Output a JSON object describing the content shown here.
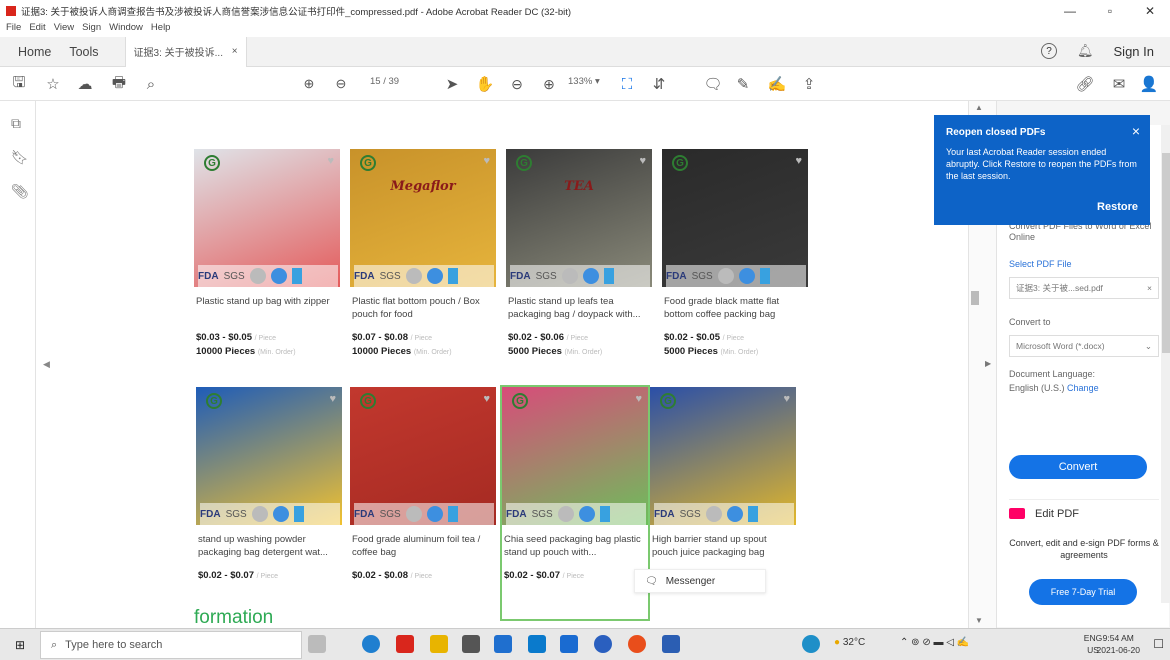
{
  "window": {
    "title": "证据3: 关于被投诉人商调查报告书及涉被投诉人商信誉案涉信息公证书打印件_compressed.pdf - Adobe Acrobat Reader DC (32-bit)"
  },
  "menu": [
    "File",
    "Edit",
    "View",
    "Sign",
    "Window",
    "Help"
  ],
  "tabs": {
    "home": "Home",
    "tools": "Tools",
    "doc": "证据3: 关于被投诉...",
    "close": "×"
  },
  "header": {
    "help_icon": "?",
    "bell_icon": "bell",
    "sign_in": "Sign In"
  },
  "toolbar": {
    "page_current": "15",
    "page_sep": "/",
    "page_total": "39",
    "zoom": "133%"
  },
  "products": [
    {
      "name": "Plastic stand up bag with zipper",
      "price": "$0.03 - $0.05",
      "price_unit": "/ Piece",
      "moq": "10000 Pieces",
      "moq_unit": "(Min. Order)",
      "image_text": "",
      "colors": [
        "#dfe3e8",
        "#e45b5b"
      ]
    },
    {
      "name": "Plastic flat bottom pouch / Box pouch for food",
      "price": "$0.07 - $0.08",
      "price_unit": "/ Piece",
      "moq": "10000 Pieces",
      "moq_unit": "(Min. Order)",
      "image_text": "Megaflor",
      "colors": [
        "#c8922a",
        "#e6b43c"
      ]
    },
    {
      "name": "Plastic stand up leafs tea packaging bag / doypack with...",
      "price": "$0.02 - $0.06",
      "price_unit": "/ Piece",
      "moq": "5000 Pieces",
      "moq_unit": "(Min. Order)",
      "image_text": "TEA",
      "colors": [
        "#3b3b3b",
        "#8a8a7a"
      ]
    },
    {
      "name": "Food grade black matte flat bottom coffee packing bag",
      "price": "$0.02 - $0.05",
      "price_unit": "/ Piece",
      "moq": "5000 Pieces",
      "moq_unit": "(Min. Order)",
      "image_text": "",
      "colors": [
        "#2a2a2a",
        "#3a3a3a"
      ]
    },
    {
      "name": "stand up washing powder packaging bag detergent wat...",
      "price": "$0.02 - $0.07",
      "price_unit": "/ Piece",
      "moq": "",
      "moq_unit": "",
      "image_text": "",
      "colors": [
        "#1e5cb8",
        "#f2c230"
      ]
    },
    {
      "name": "Food grade aluminum foil tea / coffee bag",
      "price": "$0.02 - $0.08",
      "price_unit": "/ Piece",
      "moq": "",
      "moq_unit": "",
      "image_text": "",
      "colors": [
        "#c2382e",
        "#a52a22"
      ]
    },
    {
      "name": "Chia seed packaging bag plastic stand up pouch with...",
      "price": "$0.02 - $0.07",
      "price_unit": "/ Piece",
      "moq": "",
      "moq_unit": "",
      "image_text": "",
      "colors": [
        "#d84c7a",
        "#6cbf5b"
      ]
    },
    {
      "name": "High barrier stand up spout pouch juice packaging bag",
      "price": "",
      "price_unit": "",
      "moq": "",
      "moq_unit": "",
      "image_text": "",
      "colors": [
        "#2a4fa8",
        "#e2b72a"
      ]
    }
  ],
  "cert": {
    "fda": "FDA",
    "sgs": "SGS"
  },
  "doc_text": {
    "formation": "formation"
  },
  "messenger": {
    "label": "Messenger"
  },
  "popup": {
    "title": "Reopen closed PDFs",
    "body": "Your last Acrobat Reader session ended abruptly. Click Restore to reopen the PDFs from the last session.",
    "close": "×",
    "restore": "Restore"
  },
  "right_panel": {
    "intro_partial": "Convert PDF Files to Word or Excel Online",
    "select_pdf": "Select PDF File",
    "file_name": "证据3: 关于被...sed.pdf",
    "file_clear": "×",
    "convert_to": "Convert to",
    "format": "Microsoft Word (*.docx)",
    "doc_lang": "Document Language:",
    "lang_value": "English (U.S.)",
    "lang_change": "Change",
    "convert_btn": "Convert",
    "edit_pdf": "Edit PDF",
    "promo": "Convert, edit and e-sign PDF forms & agreements",
    "trial_btn": "Free 7-Day Trial"
  },
  "taskbar": {
    "search_placeholder": "Type here to search",
    "weather": "32°C",
    "lang": "ENG",
    "region": "US",
    "time": "9:54 AM",
    "date": "2021-06-20"
  }
}
